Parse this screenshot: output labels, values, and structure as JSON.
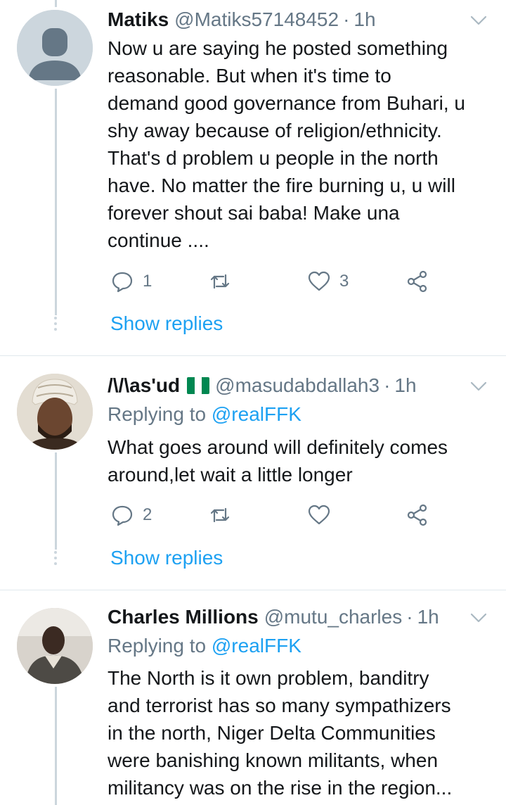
{
  "colors": {
    "link": "#1da1f2",
    "secondary": "#657786",
    "text": "#14171a",
    "divider": "#e1e8ed",
    "thread": "#ccd6dd"
  },
  "tweets": [
    {
      "name": "Matiks",
      "handle": "@Matiks57148452",
      "separator": "·",
      "time": "1h",
      "avatar_icon": "default-profile-icon",
      "text": "Now u are saying he posted something\nreasonable. But when it's time to\ndemand good governance from Buhari, u\nshy away because of religion/ethnicity.\nThat's d problem u people in the north\nhave. No matter the fire burning u, u will\nforever shout sai baba!  Make una\ncontinue ....",
      "replies": "1",
      "likes": "3",
      "show_replies": "Show replies"
    },
    {
      "name": "/\\/\\as'ud",
      "handle": "@masudabdallah3",
      "separator": "·",
      "time": "1h",
      "flag_icon": "nigeria-flag-icon",
      "replying_prefix": "Replying to",
      "replying_to": "@realFFK",
      "text": "What goes around will definitely comes\naround,let wait a little longer",
      "replies": "2",
      "likes": "",
      "show_replies": "Show replies"
    },
    {
      "name": "Charles Millions",
      "handle": "@mutu_charles",
      "separator": "·",
      "time": "1h",
      "replying_prefix": "Replying to",
      "replying_to": "@realFFK",
      "text": "The North is it own problem, banditry\nand terrorist has so many sympathizers\nin the north, Niger Delta Communities\nwere banishing known militants, when\nmilitancy was on the rise in the region..."
    }
  ]
}
